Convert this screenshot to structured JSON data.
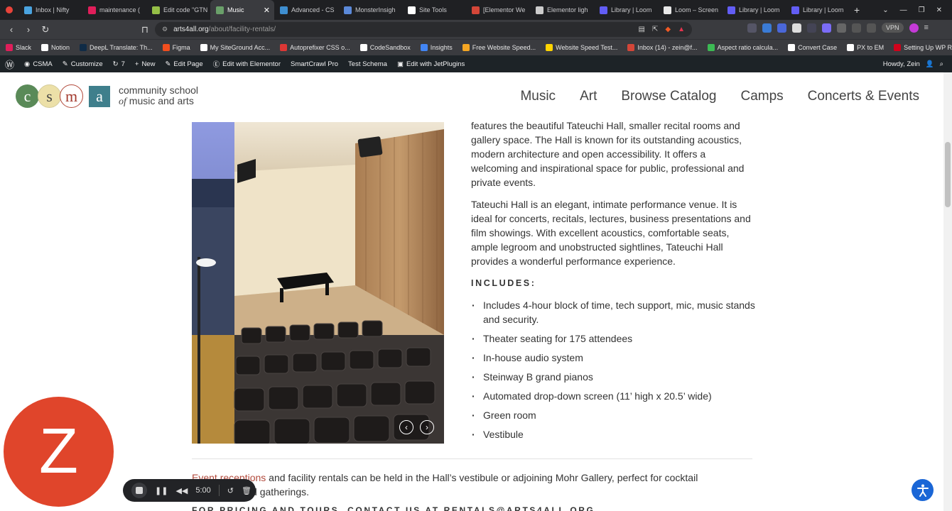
{
  "browser": {
    "tabs": [
      {
        "label": "Inbox | Nifty",
        "color": "#4aa3df",
        "active": false
      },
      {
        "label": "maintenance (",
        "color": "#e01e5a",
        "active": false
      },
      {
        "label": "Edit code \"GTN",
        "color": "#95bf47",
        "active": false
      },
      {
        "label": "Music",
        "color": "#6aa06a",
        "active": true
      },
      {
        "label": "Advanced - CS",
        "color": "#3e8ed0",
        "active": false
      },
      {
        "label": "MonsterInsigh",
        "color": "#5b89d9",
        "active": false
      },
      {
        "label": "Site Tools",
        "color": "#ffffff",
        "active": false
      },
      {
        "label": "[Elementor We",
        "color": "#d44638",
        "active": false
      },
      {
        "label": "Elementor ligh",
        "color": "#cccccc",
        "active": false
      },
      {
        "label": "Library | Loom",
        "color": "#625df5",
        "active": false
      },
      {
        "label": "Loom – Screen",
        "color": "#e8e8e8",
        "active": false
      },
      {
        "label": "Library | Loom",
        "color": "#625df5",
        "active": false
      },
      {
        "label": "Library | Loom",
        "color": "#625df5",
        "active": false
      }
    ],
    "new_tab": "+",
    "url_domain": "arts4all.org",
    "url_path": "/about/facility-rentals/",
    "vpn_label": "VPN",
    "bookmarks": [
      {
        "label": "Slack",
        "color": "#e01e5a"
      },
      {
        "label": "Notion",
        "color": "#ffffff"
      },
      {
        "label": "DeepL Translate: Th...",
        "color": "#0f2b46"
      },
      {
        "label": "Figma",
        "color": "#f24e1e"
      },
      {
        "label": "My SiteGround Acc...",
        "color": "#ffffff"
      },
      {
        "label": "Autoprefixer CSS o...",
        "color": "#dd3735"
      },
      {
        "label": "CodeSandbox",
        "color": "#ffffff"
      },
      {
        "label": "Insights",
        "color": "#4285f4"
      },
      {
        "label": "Free Website Speed...",
        "color": "#f5a623"
      },
      {
        "label": "Website Speed Test...",
        "color": "#ffd400"
      },
      {
        "label": "Inbox (14) - zein@f...",
        "color": "#d44638"
      },
      {
        "label": "Aspect ratio calcula...",
        "color": "#3cba54"
      },
      {
        "label": "Convert Case",
        "color": "#ffffff"
      },
      {
        "label": "PX to EM",
        "color": "#ffffff"
      },
      {
        "label": "Setting Up WP Roc...",
        "color": "#d0021b"
      }
    ]
  },
  "wpadmin": {
    "items": [
      "CSMA",
      "Customize",
      "7",
      "New",
      "Edit Page",
      "Edit with Elementor",
      "SmartCrawl Pro",
      "Test Schema",
      "Edit with JetPlugins"
    ],
    "greeting": "Howdy, Zein"
  },
  "site": {
    "logo_letters": [
      "c",
      "s",
      "m",
      "a"
    ],
    "logo_line1": "community school",
    "logo_line2_a": "of",
    "logo_line2_b": " music and arts",
    "nav": [
      "Music",
      "Art",
      "Browse Catalog",
      "Camps",
      "Concerts & Events"
    ]
  },
  "content": {
    "para1": "features the beautiful Tateuchi Hall, smaller recital rooms and gallery space. The Hall is known for its outstanding acoustics, modern architecture and open accessibility. It offers a welcoming and inspirational space for public, professional and private events.",
    "para2": "Tateuchi Hall is an elegant, intimate performance venue. It is ideal for concerts, recitals, lectures, business presentations and film showings. With excellent acoustics, comfortable seats, ample legroom and unobstructed sightlines, Tateuchi Hall provides a wonderful performance experience.",
    "includes_heading": "INCLUDES:",
    "includes": [
      "Includes 4-hour block of time, tech support, mic, music stands and security.",
      "Theater seating for 175 attendees",
      "In-house audio system",
      "Steinway B grand pianos",
      "Automated drop-down screen (11’ high x 20.5’ wide)",
      "Green room",
      "Vestibule"
    ],
    "bottom_link": "Event receptions",
    "bottom_rest": " and facility rentals can be held in the Hall’s vestibule or adjoining Mohr Gallery, perfect for cocktail receptions and gatherings.",
    "contact_line": "FOR PRICING AND TOURS, CONTACT US AT RENTALS@ARTS4ALL.ORG"
  },
  "slider": {
    "prev": "‹",
    "next": "›"
  },
  "overlay": {
    "avatar_initial": "Z",
    "timer": "5:00"
  }
}
